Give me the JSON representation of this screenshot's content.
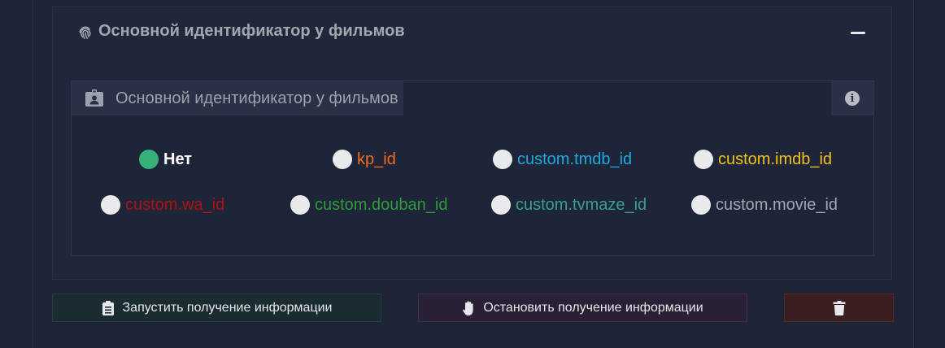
{
  "accordion": {
    "title": "Основной идентификатор у фильмов",
    "title_icon": "fingerprint-icon",
    "collapse_icon": "minus-icon"
  },
  "panel": {
    "header_label": "Основной идентификатор у фильмов",
    "header_icon": "id-badge-icon",
    "info_icon": "info-icon",
    "info_glyph": "i"
  },
  "options": [
    {
      "label": "Нет",
      "color": "#ffffff",
      "checked": true
    },
    {
      "label": "kp_id",
      "color": "#f26a1b",
      "checked": false
    },
    {
      "label": "custom.tmdb_id",
      "color": "#1ea9e1",
      "checked": false
    },
    {
      "label": "custom.imdb_id",
      "color": "#f2c21b",
      "checked": false
    },
    {
      "label": "custom.wa_id",
      "color": "#b01010",
      "checked": false
    },
    {
      "label": "custom.douban_id",
      "color": "#2f9a3a",
      "checked": false
    },
    {
      "label": "custom.tvmaze_id",
      "color": "#36a08f",
      "checked": false
    },
    {
      "label": "custom.movie_id",
      "color": "#a3a6ad",
      "checked": false
    }
  ],
  "buttons": {
    "start_label": "Запустить получение информации",
    "start_icon": "clipboard-list-icon",
    "stop_label": "Остановить получение информации",
    "stop_icon": "hand-stop-icon",
    "delete_icon": "trash-icon"
  }
}
